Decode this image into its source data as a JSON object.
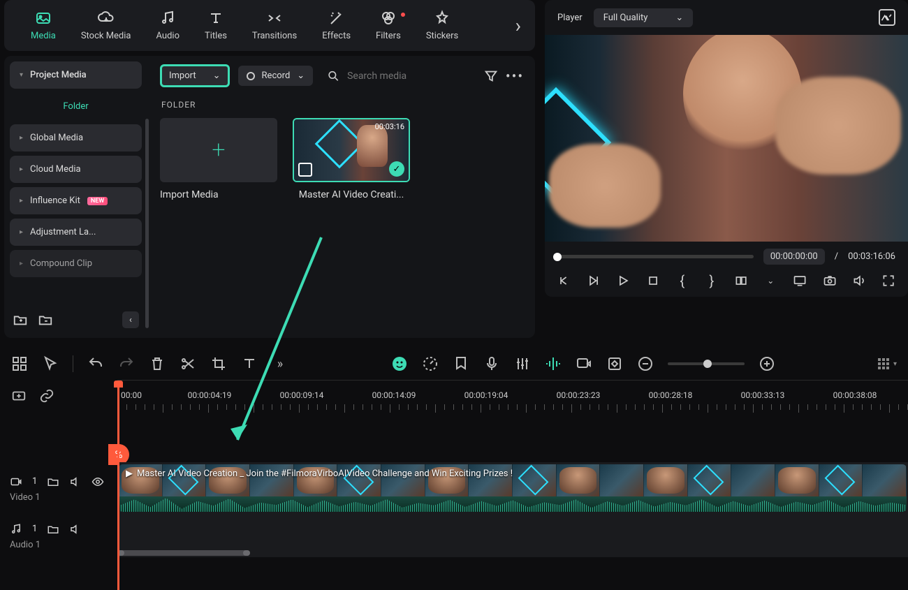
{
  "tabs": {
    "media": "Media",
    "stock": "Stock Media",
    "audio": "Audio",
    "titles": "Titles",
    "transitions": "Transitions",
    "effects": "Effects",
    "filters": "Filters",
    "stickers": "Stickers"
  },
  "sidebar": {
    "project": "Project Media",
    "folder": "Folder",
    "global": "Global Media",
    "cloud": "Cloud Media",
    "influence": "Influence Kit",
    "influence_badge": "NEW",
    "adjustment": "Adjustment La...",
    "compound": "Compound Clip"
  },
  "mediaBar": {
    "import": "Import",
    "record": "Record",
    "searchPlaceholder": "Search media"
  },
  "folderLabel": "FOLDER",
  "thumbs": {
    "importMedia": "Import Media",
    "clipName": "Master AI Video Creati...",
    "clipDuration": "00:03:16"
  },
  "player": {
    "label": "Player",
    "quality": "Full Quality",
    "current": "00:00:00:00",
    "sep": "/",
    "total": "00:03:16:06"
  },
  "ruler": {
    "t0": "00:00",
    "t1": "00:00:04:19",
    "t2": "00:00:09:14",
    "t3": "00:00:14:09",
    "t4": "00:00:19:04",
    "t5": "00:00:23:23",
    "t6": "00:00:28:18",
    "t7": "00:00:33:13",
    "t8": "00:00:38:08"
  },
  "tracks": {
    "video1": "Video 1",
    "video1_num": "1",
    "audio1": "Audio 1",
    "audio1_num": "1",
    "clipTitle": "Master AI Video Creation _ Join the #FilmoraVirboAIVideo Challenge and Win Exciting Prizes !",
    "cutBadge": "%"
  }
}
